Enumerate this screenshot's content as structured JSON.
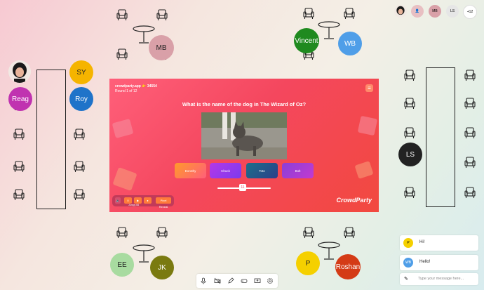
{
  "presentation": {
    "brand": "crowdparty.app 👉 34554",
    "round": "Round 1 of 12",
    "question": "What is the name of the dog in The Wizard of Oz?",
    "answers": [
      "Dorothy",
      "Chuck",
      "Toto",
      "Bolt"
    ],
    "slider_value": "11",
    "bottom_labels": [
      "Jumpy 66"
    ],
    "bottom_buttons": [
      "Pixel Reveal"
    ],
    "logo": "CrowdParty",
    "menu_glyph": "≡"
  },
  "people": {
    "mb_top": "MB",
    "vincent": "Vincent",
    "wb": "WB",
    "sy": "SY",
    "reag": "Reag",
    "roy": "Roy",
    "ls": "LS",
    "ee": "EE",
    "jk": "JK",
    "p": "P",
    "roshan": "Roshan"
  },
  "top_bar": {
    "mb": "MB",
    "ls": "LS",
    "more": "+12"
  },
  "chat": {
    "messages": [
      {
        "avatar": "P",
        "text": "Hi!"
      },
      {
        "avatar": "WB",
        "text": "Hello!"
      }
    ],
    "placeholder": "Type your message here..."
  },
  "colors": {
    "mb": "#d9a0a8",
    "vincent": "#1f8a1f",
    "wb": "#4f9ee8",
    "sy": "#f5b400",
    "reag": "#c033b0",
    "roy": "#1f73c9",
    "ls": "#222222",
    "ee": "#a8dba0",
    "jk": "#7a7a10",
    "p": "#f5d000",
    "roshan": "#d43b16"
  }
}
